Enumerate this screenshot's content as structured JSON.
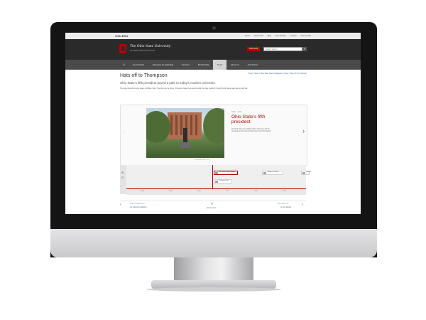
{
  "topbar": {
    "osu_link": "OSU.EDU",
    "links": [
      "Home",
      "Alumni Info",
      "Blog",
      "Find Friends",
      "Contact",
      "Give to OSU"
    ]
  },
  "header": {
    "brand": "The Ohio State University",
    "sub": "ALUMNI ASSOCIATION",
    "join": "JOIN NOW",
    "search_placeholder": "Search alumni",
    "search_icon": "magnifier-icon"
  },
  "nav": {
    "home_icon": "house-icon",
    "items": [
      "Get Involved",
      "Advocacy & Leadership",
      "Services",
      "Membership",
      "News",
      "About Us",
      "Our Stories"
    ],
    "active_index": 4
  },
  "breadcrumb": "Home  /  News  /  Ohio State Alumni Magazine  /  Issue  /  Hats off to Thompson",
  "article": {
    "title": "Hats off to Thompson",
    "subtitle": "Ohio State's fifth president paved a path to today's modern university.",
    "intro": "The larger-than-life bronze statue of William Oxley Thompson isn't a fixture. Thompson made the university what it is today, guiding it through its formative years and a world war."
  },
  "slide": {
    "date": "1899 — 1925",
    "headline": "Ohio State's fifth president",
    "body": "During his 26 years, William Oxley Thompson led the university as the student body grew into the thousands.",
    "caption": "Thompson statue, Oval",
    "prev_icon": "chevron-left-icon",
    "next_icon": "chevron-right-icon"
  },
  "timeline": {
    "zoom_in_icon": "zoom-in-icon",
    "zoom_out_icon": "zoom-out-icon",
    "items": [
      {
        "label": "Ohio State's fifth president",
        "selected": true
      },
      {
        "label": "Thompson Library",
        "selected": false
      },
      {
        "label": "Thompson Hall",
        "selected": false
      },
      {
        "label": "Campus",
        "selected": false
      }
    ],
    "ticks": [
      "1880",
      "1890",
      "1900",
      "1910",
      "1920",
      "1930"
    ]
  },
  "pager": {
    "prev_label": "PREVIOUS ARTICLE",
    "prev_link": "An inspiring tradition",
    "up_link": "Issue home",
    "up_icon": "chevron-up-icon",
    "next_label": "NEXT ARTICLE",
    "next_link": "In the Stacks"
  }
}
